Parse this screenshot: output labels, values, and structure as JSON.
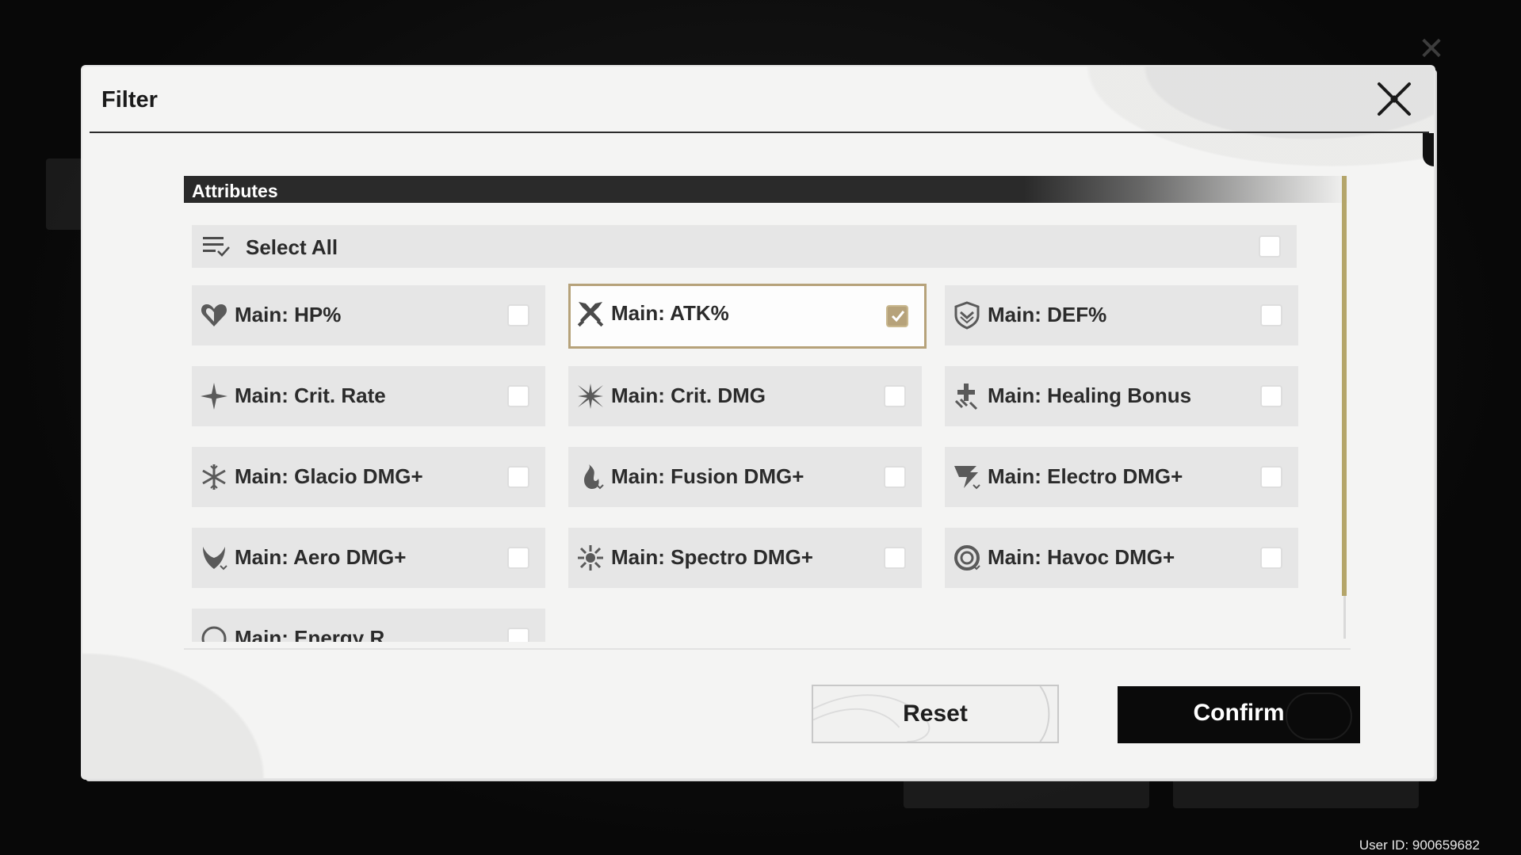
{
  "dialog": {
    "title": "Filter",
    "close_icon": "close-x-icon"
  },
  "section": {
    "label": "Attributes"
  },
  "select_all": {
    "label": "Select All",
    "icon": "list-check-icon",
    "checked": false
  },
  "options": [
    {
      "label": "Main: HP%",
      "icon": "heart-icon",
      "checked": false
    },
    {
      "label": "Main: ATK%",
      "icon": "crossed-swords-icon",
      "checked": true
    },
    {
      "label": "Main: DEF%",
      "icon": "shield-icon",
      "checked": false
    },
    {
      "label": "Main: Crit. Rate",
      "icon": "star-burst-icon",
      "checked": false
    },
    {
      "label": "Main: Crit. DMG",
      "icon": "crit-burst-icon",
      "checked": false
    },
    {
      "label": "Main: Healing Bonus",
      "icon": "healing-cross-icon",
      "checked": false
    },
    {
      "label": "Main: Glacio DMG+",
      "icon": "snowflake-icon",
      "checked": false
    },
    {
      "label": "Main: Fusion DMG+",
      "icon": "flame-icon",
      "checked": false
    },
    {
      "label": "Main: Electro DMG+",
      "icon": "lightning-icon",
      "checked": false
    },
    {
      "label": "Main: Aero DMG+",
      "icon": "wind-icon",
      "checked": false
    },
    {
      "label": "Main: Spectro DMG+",
      "icon": "sun-icon",
      "checked": false
    },
    {
      "label": "Main: Havoc DMG+",
      "icon": "vortex-icon",
      "checked": false
    },
    {
      "label": "Main: Energy R...",
      "icon": "energy-icon",
      "checked": false
    }
  ],
  "buttons": {
    "reset": "Reset",
    "confirm": "Confirm"
  },
  "footer": {
    "user_id": "User ID: 900659682"
  },
  "colors": {
    "accent_gold": "#b6a27a",
    "dark": "#2a2a2a",
    "panel": "#f4f4f3",
    "tile": "#e6e6e6"
  }
}
